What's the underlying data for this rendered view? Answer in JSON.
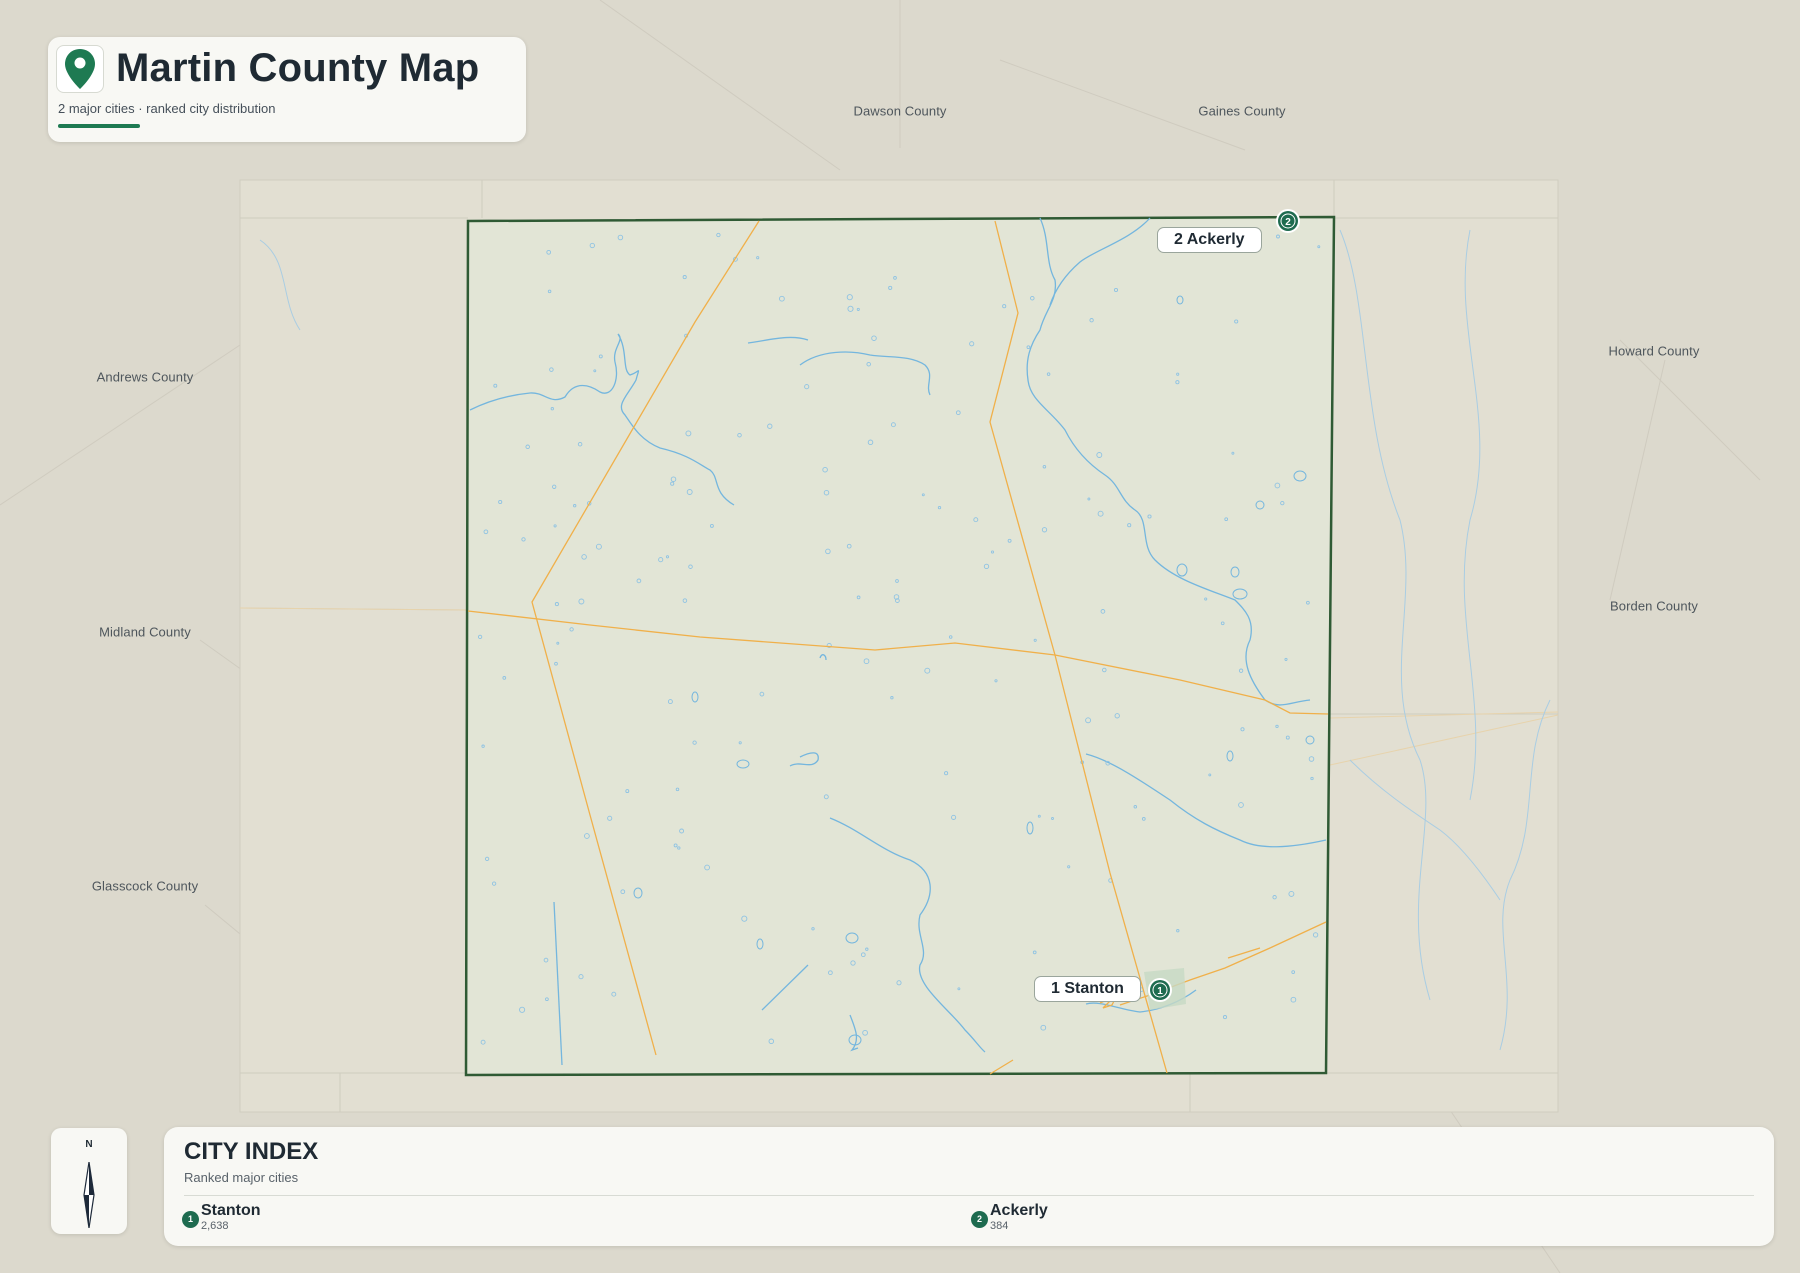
{
  "title": "Martin County Map",
  "subtitle": "2 major cities · ranked city distribution",
  "pin_icon": "map-pin-icon",
  "colors": {
    "accent": "#1e7a52",
    "county_border": "#2f5a34",
    "county_fill": "#e2e5d6",
    "road": "#f0b04a",
    "water": "#74b6de",
    "marker": "#1e6b4f",
    "background": "#dcd9cd"
  },
  "neighbor_counties": [
    {
      "name": "Dawson County"
    },
    {
      "name": "Gaines County"
    },
    {
      "name": "Andrews County"
    },
    {
      "name": "Howard County"
    },
    {
      "name": "Midland County"
    },
    {
      "name": "Borden County"
    },
    {
      "name": "Glasscock County"
    }
  ],
  "cities": [
    {
      "rank": "1",
      "name": "Stanton",
      "label": "1 Stanton",
      "population": "2,638"
    },
    {
      "rank": "2",
      "name": "Ackerly",
      "label": "2 Ackerly",
      "population": "384"
    }
  ],
  "compass": {
    "label": "N",
    "icon": "compass-needle-icon"
  },
  "index": {
    "title": "CITY INDEX",
    "subtitle": "Ranked major cities"
  }
}
